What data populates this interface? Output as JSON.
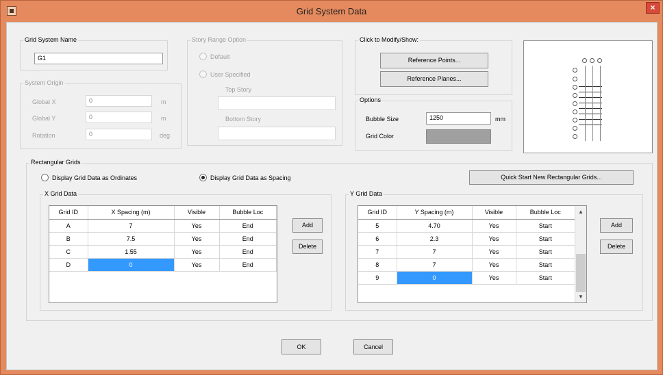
{
  "window": {
    "title": "Grid System Data"
  },
  "grid_system_name": {
    "label": "Grid System Name",
    "value": "G1"
  },
  "system_origin": {
    "label": "System Origin",
    "fields": [
      {
        "label": "Global X",
        "value": "0",
        "unit": "m"
      },
      {
        "label": "Global Y",
        "value": "0",
        "unit": "m"
      },
      {
        "label": "Rotation",
        "value": "0",
        "unit": "deg"
      }
    ]
  },
  "story_range": {
    "label": "Story Range Option",
    "default_label": "Default",
    "user_specified_label": "User Specified",
    "top_story_label": "Top Story",
    "bottom_story_label": "Bottom Story"
  },
  "click_modify": {
    "label": "Click to Modify/Show:",
    "reference_points": "Reference Points...",
    "reference_planes": "Reference Planes..."
  },
  "options": {
    "label": "Options",
    "bubble_size_label": "Bubble Size",
    "bubble_size_value": "1250",
    "bubble_size_unit": "mm",
    "grid_color_label": "Grid Color",
    "grid_color": "#a0a0a0"
  },
  "rect_grids": {
    "label": "Rectangular Grids",
    "ordinates_label": "Display Grid Data as Ordinates",
    "spacing_label": "Display Grid Data as Spacing",
    "selected": "spacing",
    "quick_start": "Quick Start New Rectangular Grids..."
  },
  "x_grid": {
    "label": "X Grid Data",
    "headers": [
      "Grid ID",
      "X Spacing (m)",
      "Visible",
      "Bubble Loc"
    ],
    "rows": [
      {
        "id": "A",
        "spacing": "7",
        "visible": "Yes",
        "bubble": "End"
      },
      {
        "id": "B",
        "spacing": "7.5",
        "visible": "Yes",
        "bubble": "End"
      },
      {
        "id": "C",
        "spacing": "1.55",
        "visible": "Yes",
        "bubble": "End"
      },
      {
        "id": "D",
        "spacing": "0",
        "visible": "Yes",
        "bubble": "End"
      }
    ],
    "add": "Add",
    "delete": "Delete"
  },
  "y_grid": {
    "label": "Y Grid Data",
    "headers": [
      "Grid ID",
      "Y Spacing (m)",
      "Visible",
      "Bubble Loc"
    ],
    "rows": [
      {
        "id": "5",
        "spacing": "4.70",
        "visible": "Yes",
        "bubble": "Start"
      },
      {
        "id": "6",
        "spacing": "2.3",
        "visible": "Yes",
        "bubble": "Start"
      },
      {
        "id": "7",
        "spacing": "7",
        "visible": "Yes",
        "bubble": "Start"
      },
      {
        "id": "8",
        "spacing": "7",
        "visible": "Yes",
        "bubble": "Start"
      },
      {
        "id": "9",
        "spacing": "0",
        "visible": "Yes",
        "bubble": "Start"
      }
    ],
    "add": "Add",
    "delete": "Delete"
  },
  "buttons": {
    "ok": "OK",
    "cancel": "Cancel"
  },
  "colors": {
    "titlebar": "#e48a5e",
    "selection": "#3399ff"
  }
}
